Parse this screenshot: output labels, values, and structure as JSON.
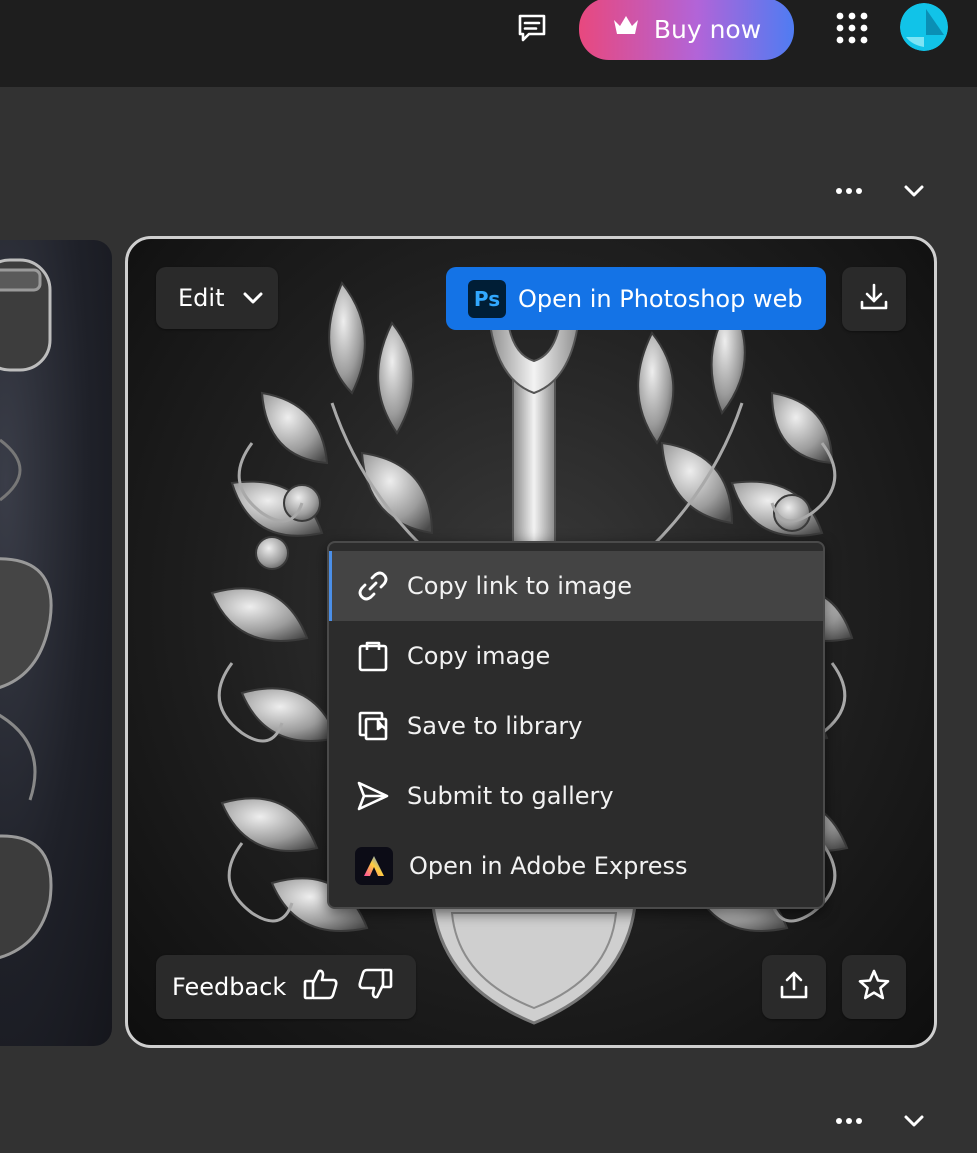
{
  "header": {
    "buy_label": "Buy now",
    "icons": [
      "chat-icon",
      "crown-icon",
      "apps-grid-icon",
      "avatar"
    ]
  },
  "card": {
    "edit_label": "Edit",
    "open_ps_label": "Open in Photoshop web",
    "ps_logo_text": "Ps",
    "feedback_label": "Feedback"
  },
  "menu": {
    "items": [
      {
        "label": "Copy link to image",
        "icon": "link-icon"
      },
      {
        "label": "Copy image",
        "icon": "clipboard-icon"
      },
      {
        "label": "Save to library",
        "icon": "library-icon"
      },
      {
        "label": "Submit to gallery",
        "icon": "send-icon"
      },
      {
        "label": "Open in Adobe Express",
        "icon": "adobe-express-icon"
      }
    ]
  },
  "colors": {
    "accent_blue": "#1473e6",
    "buy_gradient": [
      "#e8487e",
      "#b264d8",
      "#4f7cf2"
    ],
    "background": "#323232",
    "topbar": "#1e1e1e"
  }
}
